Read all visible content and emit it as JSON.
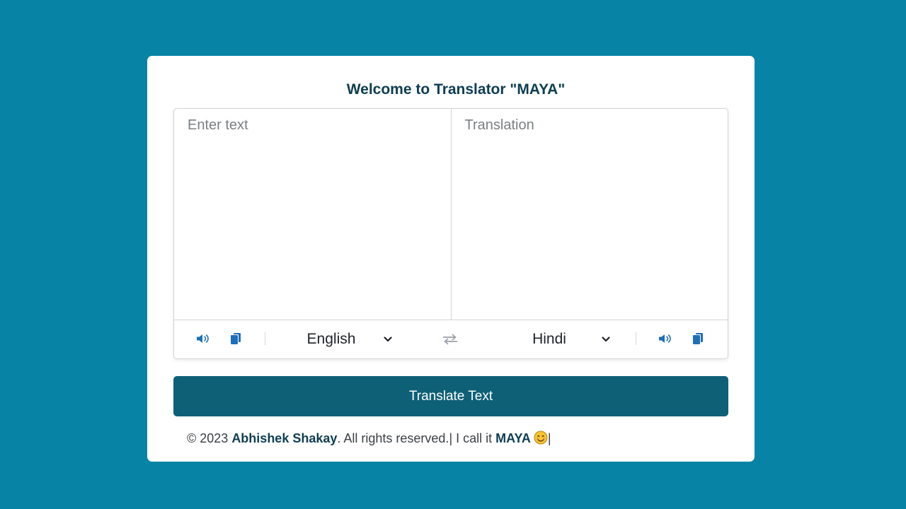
{
  "app": {
    "title": "Welcome to Translator \"MAYA\""
  },
  "input": {
    "from_placeholder": "Enter text",
    "from_value": "",
    "to_placeholder": "Translation",
    "to_value": ""
  },
  "controls": {
    "from_language": "English",
    "to_language": "Hindi",
    "icons": {
      "speak": "speaker-icon",
      "copy": "copy-icon",
      "swap": "exchange-icon",
      "dropdown": "chevron-down-icon"
    }
  },
  "actions": {
    "translate_label": "Translate Text"
  },
  "footer": {
    "copyright": "© 2023 ",
    "author": "Abhishek Shakay",
    "rights": ". All rights reserved.| I call it ",
    "nickname": "MAYA",
    "end": "|"
  },
  "colors": {
    "background": "#0683a5",
    "button": "#0e6077",
    "icon_accent": "#1f6fb8",
    "title": "#0e3d52"
  }
}
